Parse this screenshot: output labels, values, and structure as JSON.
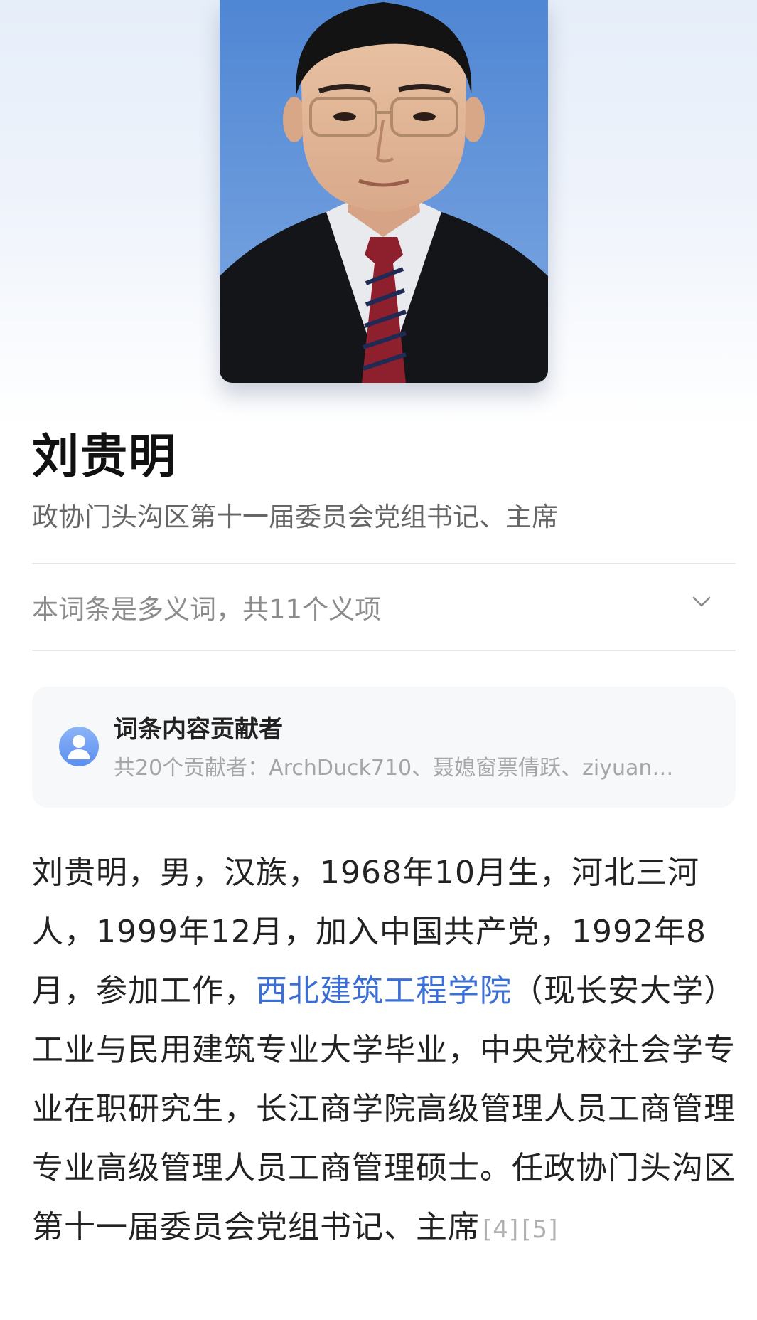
{
  "person": {
    "name": "刘贵明",
    "subtitle": "政协门头沟区第十一届委员会党组书记、主席"
  },
  "polysemy": {
    "label": "本词条是多义词，共11个义项",
    "icon": "chevron-down-icon"
  },
  "contributors": {
    "title": "词条内容贡献者",
    "list": "共20个贡献者：ArchDuck710、聂媳窗票倩跃、ziyuan…",
    "icon": "user-avatar-icon"
  },
  "bio": {
    "part1": "刘贵明，男，汉族，1968年10月生，河北三河人，1999年12月，加入中国共产党，1992年8月，参加工作，",
    "link": "西北建筑工程学院",
    "part2": "（现长安大学）工业与民用建筑专业大学毕业，中央党校社会学专业在职研究生，长江商学院高级管理人员工商管理专业高级管理人员工商管理硕士。任政协门头沟区第十一届委员会党组书记、主席",
    "ref1": "[4]",
    "ref2": "[5]"
  },
  "colors": {
    "link": "#3b6fd6",
    "portrait_bg": "#5b8ed6",
    "avatar": "#6a9af2"
  }
}
